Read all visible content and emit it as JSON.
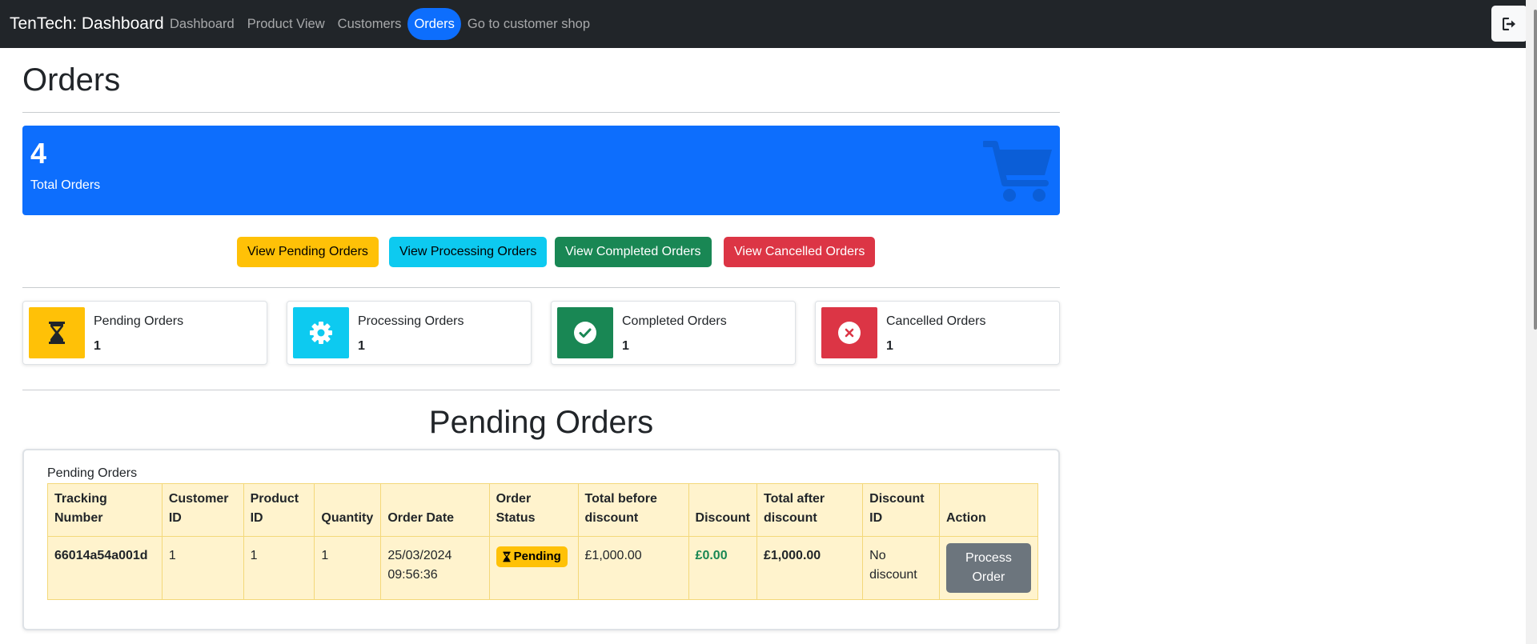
{
  "nav": {
    "brand": "TenTech: Dashboard",
    "links": [
      "Dashboard",
      "Product View",
      "Customers",
      "Orders",
      "Go to customer shop"
    ],
    "active_link": "Orders",
    "logout_icon": "sign-out-icon"
  },
  "page": {
    "title": "Orders"
  },
  "total": {
    "count": "4",
    "label": "Total Orders",
    "icon": "cart-icon"
  },
  "filters": [
    {
      "label": "View Pending Orders",
      "color": "#ffc107"
    },
    {
      "label": "View Processing Orders",
      "color": "#0dcaf0"
    },
    {
      "label": "View Completed Orders",
      "color": "#198754"
    },
    {
      "label": "View Cancelled Orders",
      "color": "#dc3545"
    }
  ],
  "stats": [
    {
      "label": "Pending Orders",
      "value": "1",
      "icon": "hourglass-icon",
      "color": "#ffc107"
    },
    {
      "label": "Processing Orders",
      "value": "1",
      "icon": "gear-icon",
      "color": "#0dcaf0"
    },
    {
      "label": "Completed Orders",
      "value": "1",
      "icon": "check-circle-icon",
      "color": "#198754"
    },
    {
      "label": "Cancelled Orders",
      "value": "1",
      "icon": "x-circle-icon",
      "color": "#dc3545"
    }
  ],
  "section": {
    "title": "Pending Orders",
    "caption": "Pending Orders",
    "headers": [
      [
        "Tracking",
        "Number"
      ],
      [
        "Customer",
        "ID"
      ],
      [
        "Product",
        "ID"
      ],
      [
        "Quantity"
      ],
      [
        "Order Date"
      ],
      [
        "Order",
        "Status"
      ],
      [
        "Total before",
        "discount"
      ],
      [
        "Discount"
      ],
      [
        "Total after",
        "discount"
      ],
      [
        "Discount",
        "ID"
      ],
      [
        "Action"
      ]
    ],
    "rows": [
      {
        "tracking": "66014a54a001d",
        "customer_id": "1",
        "product_id": "1",
        "quantity": "1",
        "date": "25/03/2024",
        "time": "09:56:36",
        "status": "Pending",
        "total_before": "£1,000.00",
        "discount": "£0.00",
        "total_after": "£1,000.00",
        "discount_id_1": "No",
        "discount_id_2": "discount",
        "action_1": "Process",
        "action_2": "Order"
      }
    ]
  }
}
